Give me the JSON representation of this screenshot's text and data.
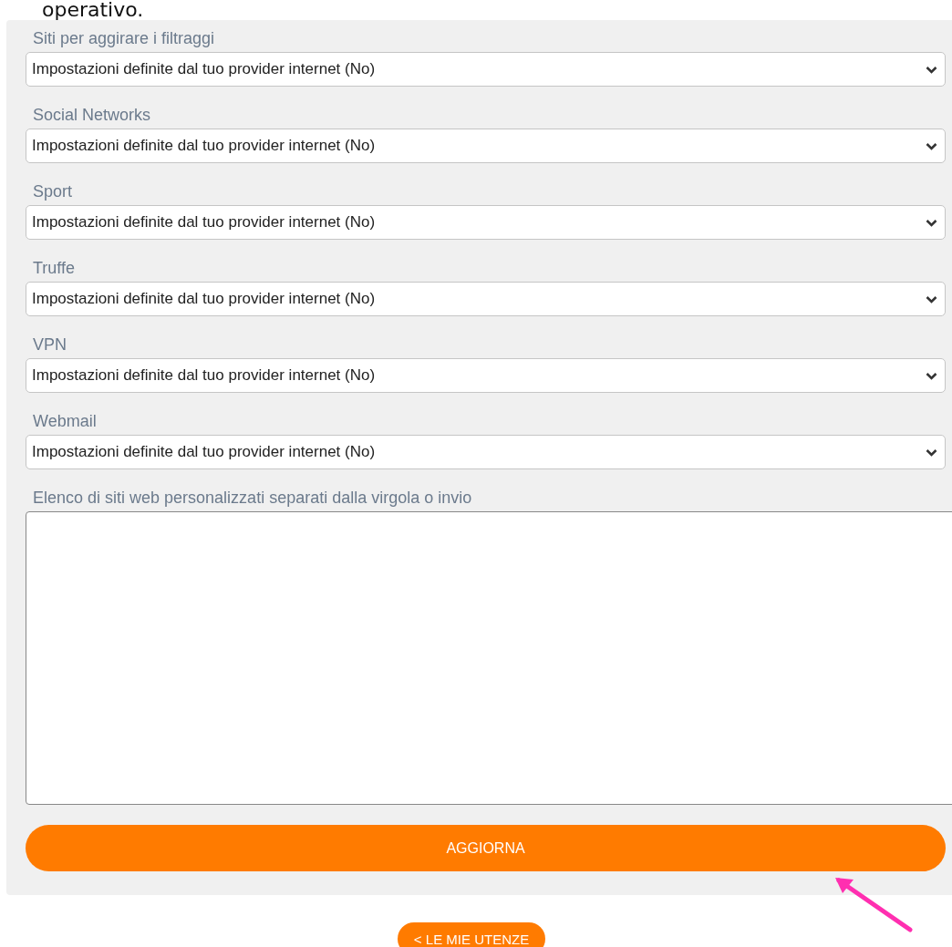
{
  "intro_text": "operativo.",
  "categories": [
    {
      "label": "Siti per aggirare i filtraggi",
      "value": "Impostazioni definite dal tuo provider internet (No)"
    },
    {
      "label": "Social Networks",
      "value": "Impostazioni definite dal tuo provider internet (No)"
    },
    {
      "label": "Sport",
      "value": "Impostazioni definite dal tuo provider internet (No)"
    },
    {
      "label": "Truffe",
      "value": "Impostazioni definite dal tuo provider internet (No)"
    },
    {
      "label": "VPN",
      "value": "Impostazioni definite dal tuo provider internet (No)"
    },
    {
      "label": "Webmail",
      "value": "Impostazioni definite dal tuo provider internet (No)"
    }
  ],
  "custom_sites": {
    "label": "Elenco di siti web personalizzati separati dalla virgola o invio"
  },
  "submit_button": "AGGIORNA",
  "back_button": "< LE MIE UTENZE"
}
